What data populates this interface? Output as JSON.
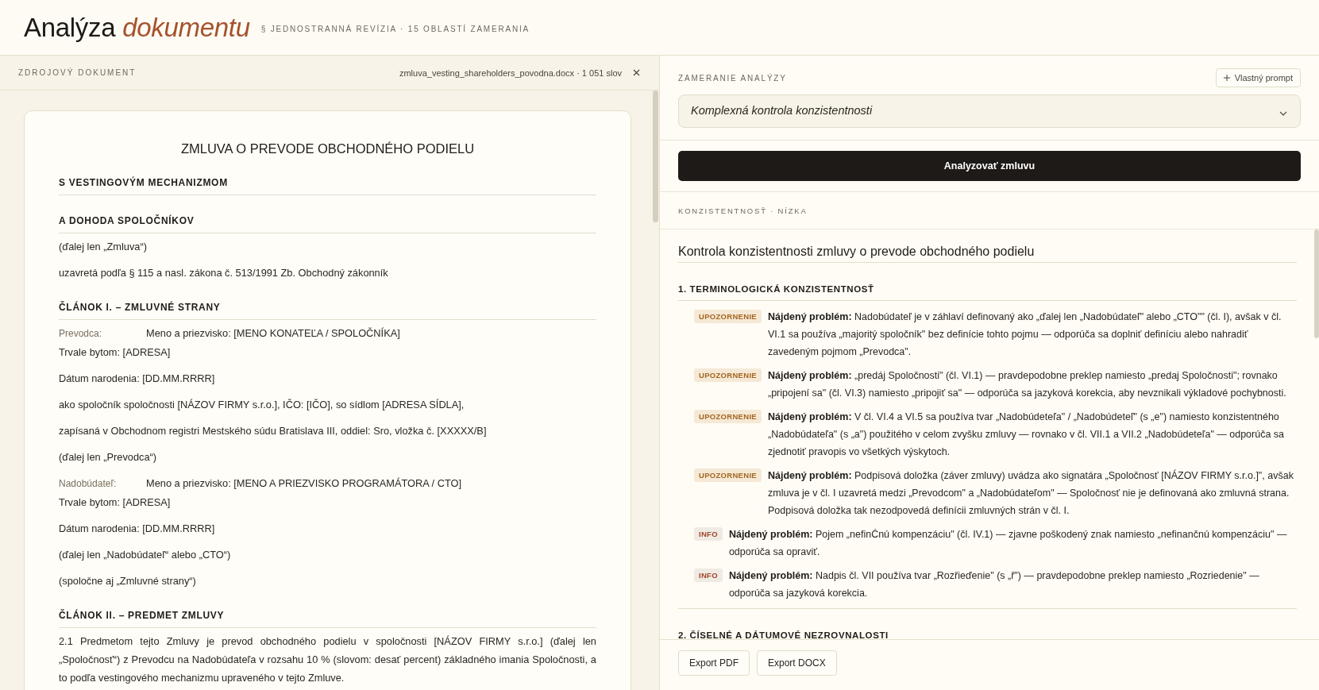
{
  "header": {
    "title": "Analýza *dokumentu*",
    "subtitle": "§ JEDNOSTRANNÁ REVÍZIA · 15 OBLASTÍ ZAMERANIA"
  },
  "source_document": {
    "label": "ZDROJOVÝ DOKUMENT",
    "file_info": "zmluva_vesting_shareholders_povodna.docx · 1 051 slov",
    "document": {
      "title": "ZMLUVA O PREVODE OBCHODNÉHO PODIELU",
      "blocks": [
        {
          "kind": "heading",
          "text": "S VESTINGOVÝM MECHANIZMOM"
        },
        {
          "kind": "heading",
          "text": "A DOHODA SPOLOČNÍKOV"
        },
        {
          "kind": "paragraph",
          "text": "(ďalej len „Zmluva“)"
        },
        {
          "kind": "paragraph",
          "text": "uzavretá podľa § 115 a nasl. zákona č. 513/1991 Zb. Obchodný zákonník"
        },
        {
          "kind": "heading",
          "text": "ČLÁNOK I. – ZMLUVNÉ STRANY"
        },
        {
          "kind": "party",
          "label": "Prevodca:",
          "lines": [
            "Meno a priezvisko: [MENO KONATEĽA / SPOLOČNÍKA]",
            "Trvale bytom: [ADRESA]"
          ]
        },
        {
          "kind": "paragraph",
          "text": "Dátum narodenia: [DD.MM.RRRR]"
        },
        {
          "kind": "paragraph",
          "text": "ako spoločník spoločnosti [NÁZOV FIRMY s.r.o.], IČO: [IČO], so sídlom [ADRESA SÍDLA],"
        },
        {
          "kind": "paragraph",
          "text": "zapísaná v Obchodnom registri Mestského súdu Bratislava III, oddiel: Sro, vložka č. [XXXXX/B]"
        },
        {
          "kind": "paragraph",
          "text": "(ďalej len „Prevodca“)"
        },
        {
          "kind": "party",
          "label": "Nadobúdateľ:",
          "lines": [
            "Meno a priezvisko: [MENO A PRIEZVISKO PROGRAMÁTORA / CTO]",
            "Trvale bytom: [ADRESA]"
          ]
        },
        {
          "kind": "paragraph",
          "text": "Dátum narodenia: [DD.MM.RRRR]"
        },
        {
          "kind": "paragraph",
          "text": "(ďalej len „Nadobúdateľ“ alebo „CTO“)"
        },
        {
          "kind": "paragraph",
          "text": "(spoločne aj „Zmluvné strany“)"
        },
        {
          "kind": "heading",
          "text": "ČLÁNOK II. – PREDMET ZMLUVY"
        },
        {
          "kind": "paragraph",
          "text": "2.1 Predmetom tejto Zmluvy je prevod obchodného podielu v spoločnosti [NÁZOV FIRMY s.r.o.] (ďalej len „Spoločnosť“) z Prevodcu na Nadobúdateľa v rozsahu 10 % (slovom: desať percent) základného imania Spoločnosti, a to podľa vestingového mechanizmu upraveného v tejto Zmluve."
        }
      ]
    }
  },
  "analysis": {
    "label": "ZAMERANIE ANALÝZY",
    "custom_prompt_button": "Vlastný prompt",
    "focus_select": {
      "value": "Komplexná kontrola konzistentnosti"
    },
    "analyze_button": "Analyzovať zmluvu",
    "result_label": "KONZISTENTNOSŤ · NÍZKA",
    "report": {
      "title": "Kontrola konzistentnosti zmluvy o prevode obchodného podielu",
      "sections": [
        {
          "heading": "1. TERMINOLOGICKÁ KONZISTENTNOSŤ",
          "findings": [
            {
              "kind": "warning",
              "badge": "UPOZORNENIE",
              "text": "**Nájdený problém:** Nadobúdateľ je v záhlaví definovaný ako „ďalej len „Nadobúdateľ\" alebo „CTO\"\" (čl. I), avšak v čl. VI.1 sa používa „majoritý spoločník\" bez definície tohto pojmu — odporúča sa doplniť definíciu alebo nahradiť zavedeným pojmom „Prevodca\"."
            },
            {
              "kind": "warning",
              "badge": "UPOZORNENIE",
              "text": "**Nájdený problém:** „predáj Spoločnosti\" (čl. VI.1) — pravdepodobne preklep namiesto „predaj Spoločnosti\"; rovnako „pripojení sa\" (čl. VI.3) namiesto „pripojiť sa\" — odporúča sa jazyková korekcia, aby nevznikali výkladové pochybnosti."
            },
            {
              "kind": "warning",
              "badge": "UPOZORNENIE",
              "text": "**Nájdený problém:** V čl. VI.4 a VI.5 sa používa tvar „Nadobúdeteľa\" / „Nadobúdeteľ\" (s „e\") namiesto konzistentného „Nadobúdateľa\" (s „a\") použitého v celom zvyšku zmluvy — rovnako v čl. VII.1 a VII.2 „Nadobúdeteľa\" — odporúča sa zjednotiť pravopis vo všetkých výskytoch."
            },
            {
              "kind": "warning",
              "badge": "UPOZORNENIE",
              "text": "**Nájdený problém:** Podpisová doložka (záver zmluvy) uvádza ako signatára „Spoločnosť [NÁZOV FIRMY s.r.o.]\", avšak zmluva je v čl. I uzavretá medzi „Prevodcom\" a „Nadobúdateľom\" — Spoločnosť nie je definovaná ako zmluvná strana. Podpisová doložka tak nezodpovedá definícii zmluvných strán v čl. I."
            },
            {
              "kind": "info",
              "badge": "INFO",
              "text": "**Nájdený problém:** Pojem „nefinĊnú kompenzáciu\" (čl. IV.1) — zjavne poškodený znak namiesto „nefinančnú kompenzáciu\" — odporúča sa opraviť."
            },
            {
              "kind": "info",
              "badge": "INFO",
              "text": "**Nájdený problém:** Nadpis čl. VII používa tvar „Rozřieďenie\" (s „ř\") — pravdepodobne preklep namiesto „Rozriedenie\" — odporúča sa jazyková korekcia."
            }
          ]
        },
        {
          "heading": "2. ČÍSELNÉ A DÁTUMOVÉ NEZROVNALOSTI"
        }
      ]
    },
    "export_buttons": [
      "Export PDF",
      "Export DOCX"
    ]
  }
}
